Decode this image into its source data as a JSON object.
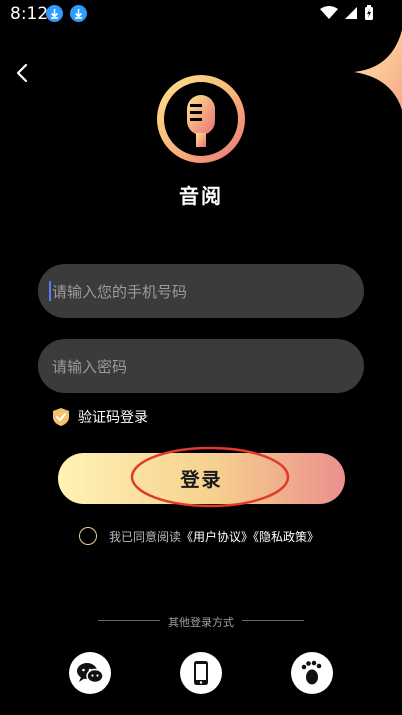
{
  "status_bar": {
    "time": "8:12"
  },
  "app": {
    "name": "音阅"
  },
  "form": {
    "phone_placeholder": "请输入您的手机号码",
    "password_placeholder": "请输入密码",
    "sms_login_label": "验证码登录",
    "login_button_label": "登录"
  },
  "agreement": {
    "prefix": "我已同意阅读",
    "user_agreement": "《用户协议》",
    "privacy_policy": "《隐私政策》"
  },
  "other_login": {
    "title": "其他登录方式",
    "methods": [
      "wechat-icon",
      "phone-icon",
      "footprint-icon"
    ]
  },
  "colors": {
    "background": "#000000",
    "input_bg": "#3b3b3b",
    "accent_gradient_start": "#fff3b5",
    "accent_gradient_end": "#eb8f8d",
    "annotation": "#e03a2a"
  }
}
